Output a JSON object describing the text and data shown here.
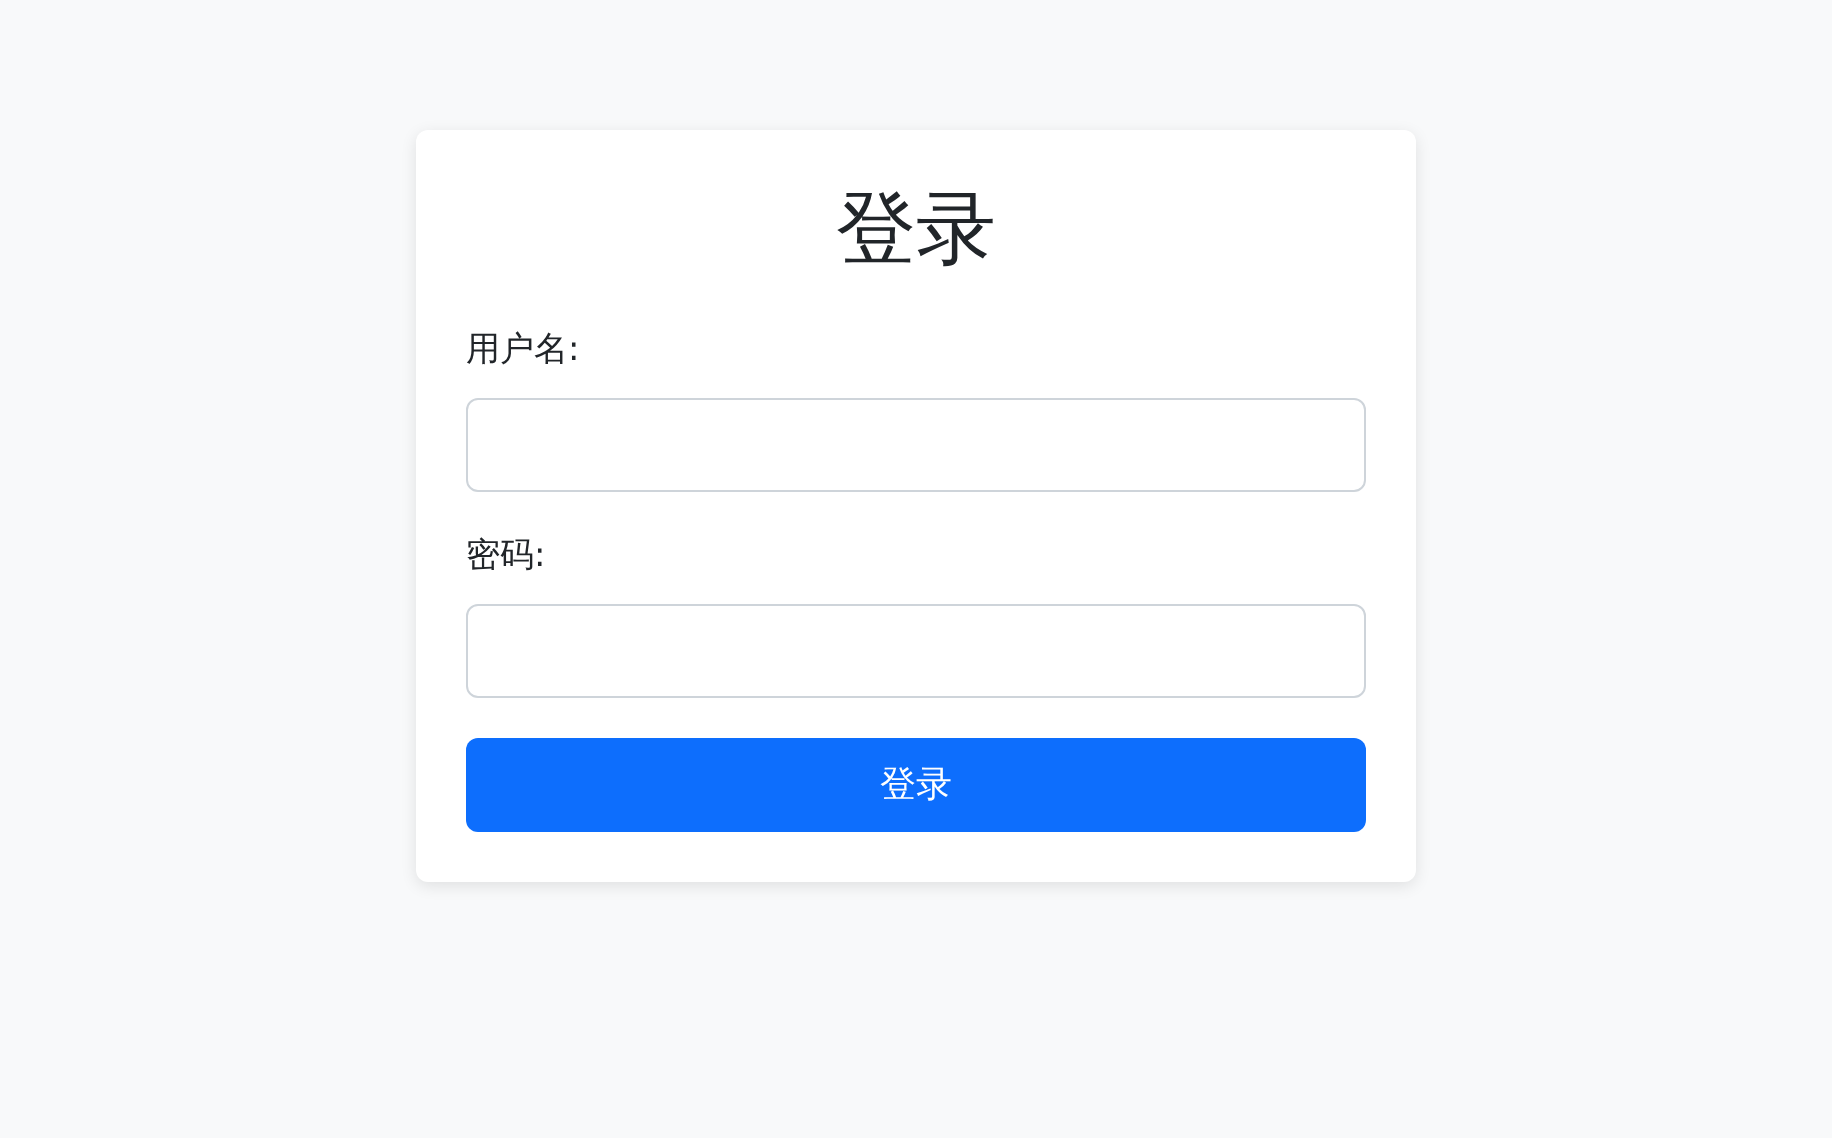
{
  "title": "登录",
  "fields": [
    {
      "label": "用户名:"
    },
    {
      "label": "密码:"
    }
  ],
  "submit": {
    "label": "登录"
  }
}
